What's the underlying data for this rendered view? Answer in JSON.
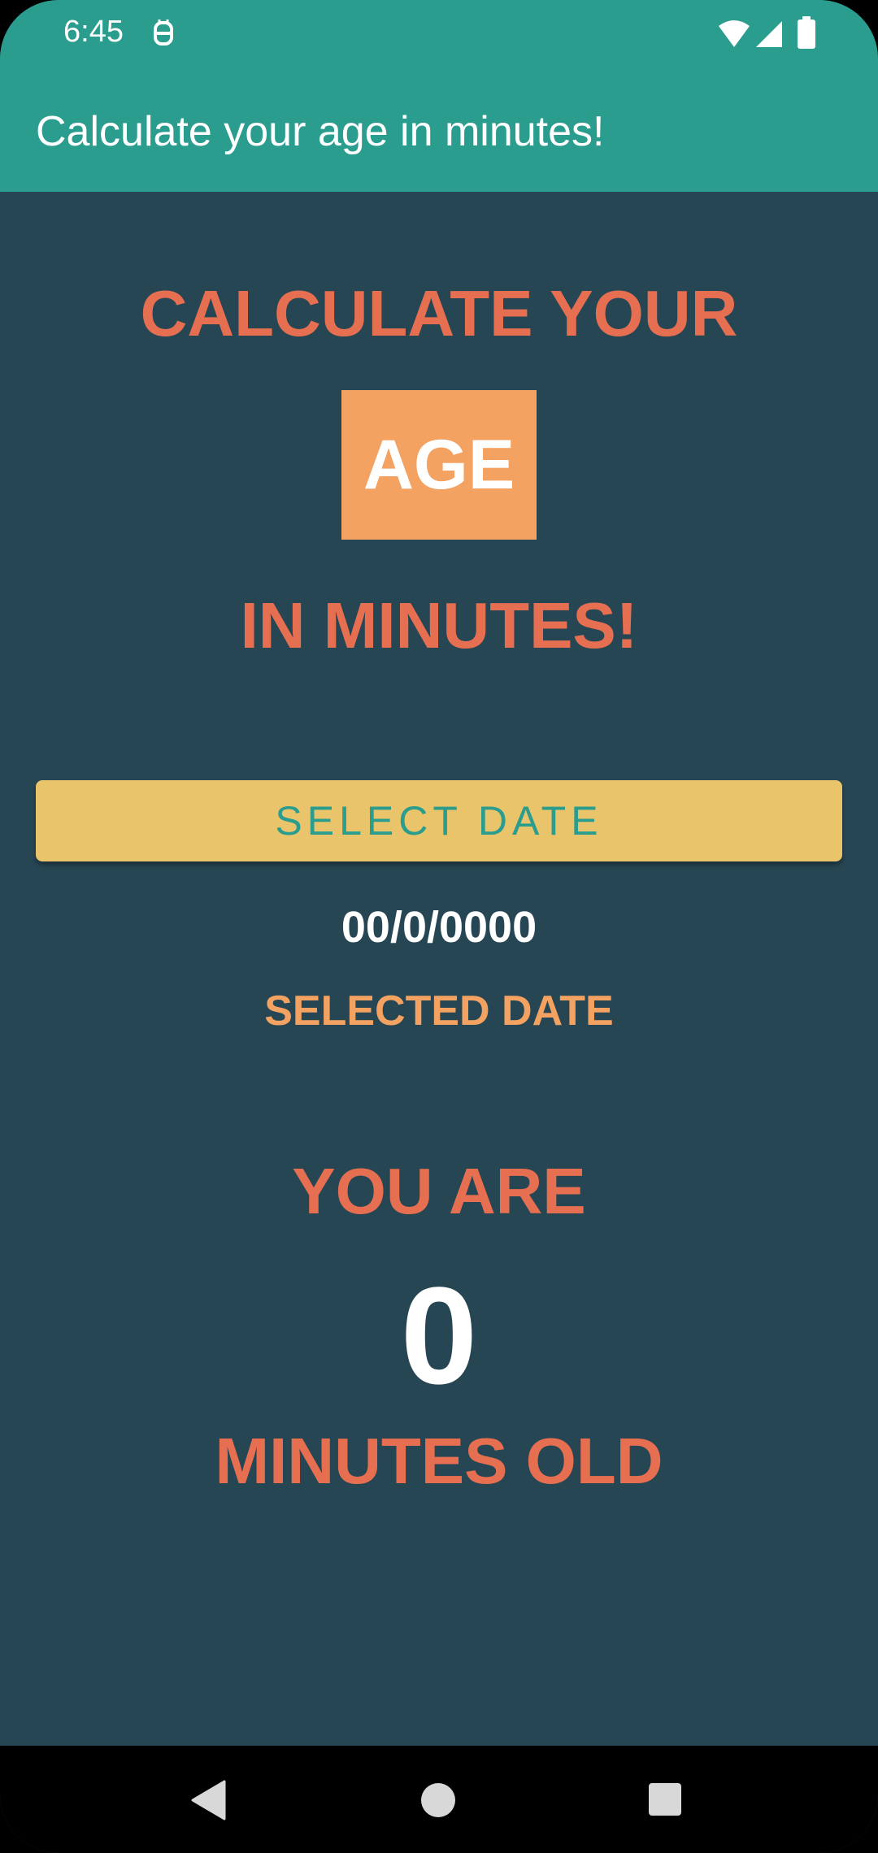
{
  "status_bar": {
    "time": "6:45",
    "icons": [
      "notification-icon",
      "wifi-icon",
      "signal-icon",
      "battery-icon"
    ]
  },
  "app_bar": {
    "title": "Calculate your age in minutes!"
  },
  "hero": {
    "line1": "CALCULATE YOUR",
    "highlight": "AGE",
    "line2": "IN MINUTES!"
  },
  "select_button": {
    "label": "SELECT DATE"
  },
  "selected_date": {
    "value": "00/0/0000",
    "caption": "SELECTED DATE"
  },
  "result": {
    "prefix": "YOU ARE",
    "minutes": "0",
    "suffix": "MINUTES OLD"
  },
  "navigation": {
    "buttons": [
      "back-icon",
      "home-icon",
      "recents-icon"
    ]
  },
  "colors": {
    "primary": "#2a9d8f",
    "background": "#274653",
    "accent": "#e76f51",
    "highlight": "#f4a261",
    "button": "#e9c46a",
    "text": "#ffffff"
  }
}
